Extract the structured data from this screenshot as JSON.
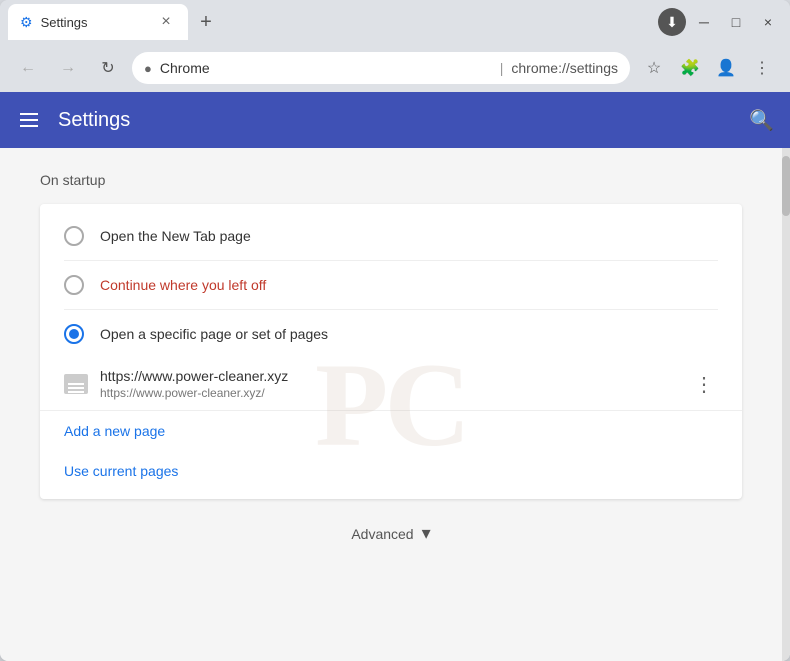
{
  "window": {
    "tab": {
      "favicon": "⚙",
      "title": "Settings",
      "close": "×"
    },
    "new_tab_btn": "+",
    "controls": {
      "minimize": "─",
      "maximize": "□",
      "close": "×"
    },
    "download_icon": "⬇"
  },
  "addressbar": {
    "back": "←",
    "forward": "→",
    "refresh": "↻",
    "favicon": "●",
    "browser_name": "Chrome",
    "separator": "|",
    "url": "chrome://settings",
    "star_icon": "☆",
    "puzzle_icon": "🧩",
    "avatar_icon": "👤",
    "menu_icon": "⋮"
  },
  "header": {
    "title": "Settings",
    "search_icon": "🔍"
  },
  "main": {
    "section_title": "On startup",
    "options": [
      {
        "id": "opt1",
        "label": "Open the New Tab page",
        "selected": false,
        "warn": false
      },
      {
        "id": "opt2",
        "label": "Continue where you left off",
        "selected": false,
        "warn": true
      },
      {
        "id": "opt3",
        "label": "Open a specific page or set of pages",
        "selected": true,
        "warn": false
      }
    ],
    "url_entry": {
      "title": "https://www.power-cleaner.xyz",
      "subtitle": "https://www.power-cleaner.xyz/",
      "more": "⋮"
    },
    "add_new_page": "Add a new page",
    "use_current_pages": "Use current pages",
    "advanced": {
      "label": "Advanced",
      "arrow": "▾"
    }
  },
  "colors": {
    "accent_blue": "#3f51b5",
    "link_blue": "#1a73e8",
    "warn_red": "#c0392b"
  }
}
